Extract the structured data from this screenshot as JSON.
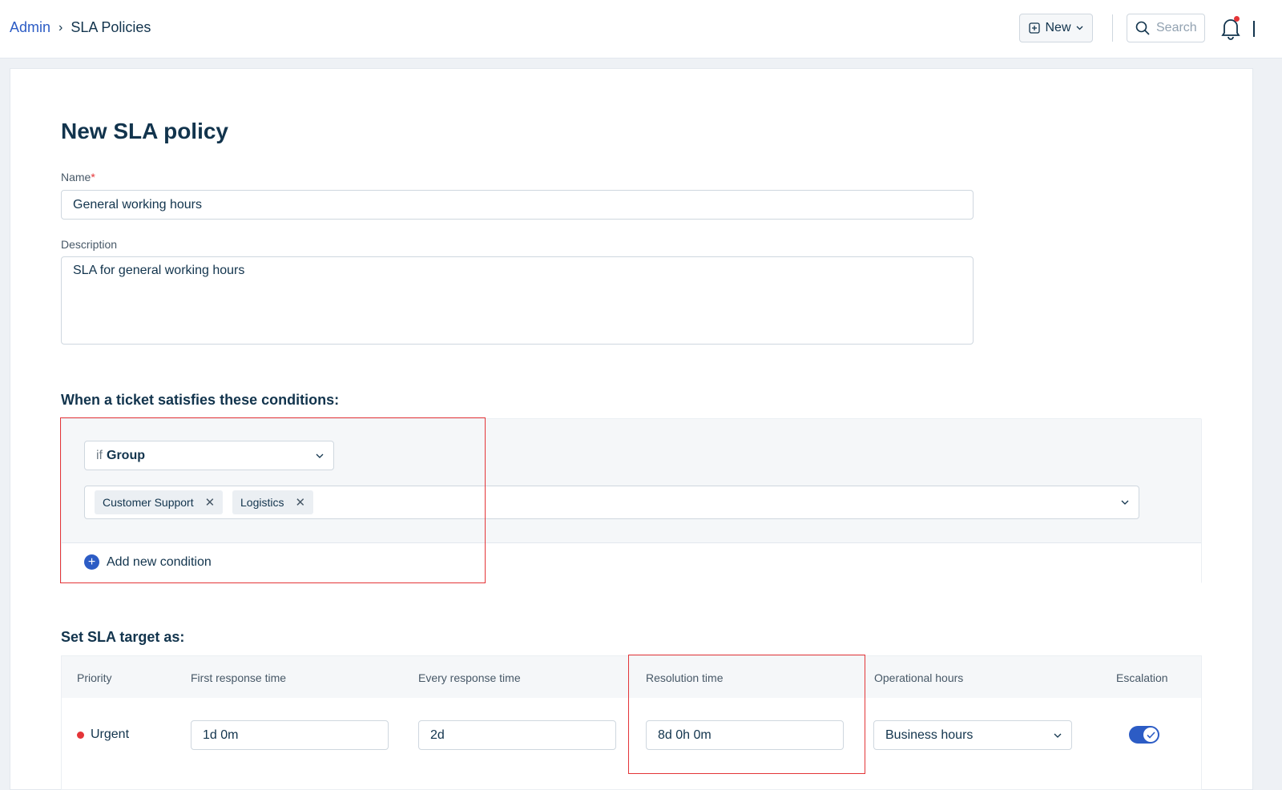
{
  "breadcrumb": {
    "parent": "Admin",
    "separator": "›",
    "current": "SLA Policies"
  },
  "header": {
    "new_label": "New",
    "search_placeholder": "Search"
  },
  "form": {
    "title": "New SLA policy",
    "name_label": "Name",
    "required_marker": "*",
    "name_value": "General working hours",
    "description_label": "Description",
    "description_value": "SLA for general working hours"
  },
  "conditions": {
    "title": "When a ticket satisfies these conditions:",
    "if_word": "if",
    "field": "Group",
    "tags": [
      {
        "label": "Customer Support"
      },
      {
        "label": "Logistics"
      }
    ],
    "add_label": "Add new condition"
  },
  "sla_target": {
    "title": "Set SLA target as:",
    "columns": [
      "Priority",
      "First response time",
      "Every response time",
      "Resolution time",
      "Operational hours",
      "Escalation"
    ],
    "rows": [
      {
        "priority": "Urgent",
        "priority_color": "#e43538",
        "first_response": "1d 0m",
        "every_response": "2d",
        "resolution": "8d 0h 0m",
        "operational_hours": "Business hours",
        "escalation": true
      }
    ]
  },
  "colors": {
    "accent": "#2c5cc5",
    "highlight": "#e43538",
    "text": "#12344d"
  },
  "icons": {
    "new": "plus-square-icon",
    "search": "search-icon",
    "bell": "bell-icon",
    "add": "plus-circle-icon",
    "remove": "close-icon"
  }
}
